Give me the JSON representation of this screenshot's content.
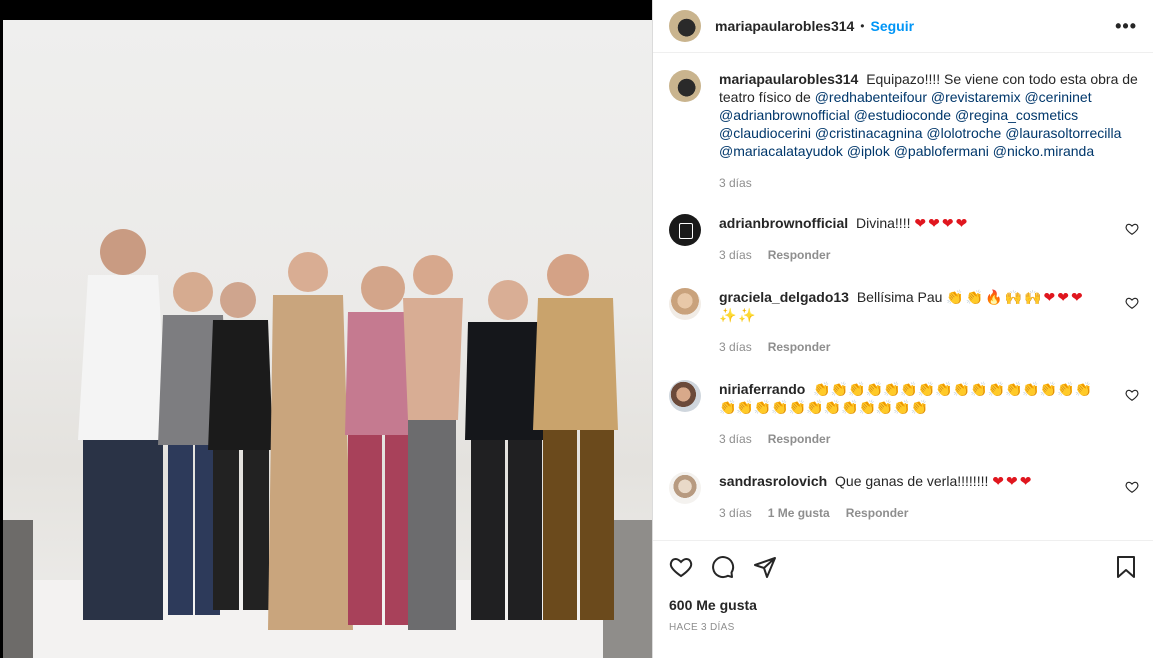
{
  "post": {
    "owner": "mariapaularobles314",
    "follow_label": "Seguir",
    "separator": "•",
    "more_label": "•••"
  },
  "caption": {
    "user": "mariapaularobles314",
    "text": "Equipazo!!!! Se viene con todo esta obra de teatro físico de",
    "mentions": "@redhabenteifour @revistaremix @cerininet @adrianbrownofficial @estudioconde @regina_cosmetics @claudiocerini @cristinacagnina @lolotroche @laurasoltorrecilla @mariacalatayudok @iplok @pablofermani @nicko.miranda",
    "time": "3 días"
  },
  "comments": [
    {
      "user": "adrianbrownofficial",
      "text": "Divina!!!!",
      "emoji": "❤❤❤❤",
      "time": "3 días",
      "reply": "Responder"
    },
    {
      "user": "graciela_delgado13",
      "text": "Bellísima Pau",
      "emoji": "👏👏🔥🙌🙌❤❤❤ ✨✨",
      "time": "3 días",
      "reply": "Responder"
    },
    {
      "user": "niriaferrando",
      "text": "",
      "emoji": "👏👏👏👏👏👏👏👏👏👏👏👏👏👏👏👏 👏👏👏👏👏👏👏👏👏👏👏👏",
      "time": "3 días",
      "reply": "Responder"
    },
    {
      "user": "sandrasrolovich",
      "text": "Que ganas de verla!!!!!!!!",
      "emoji": "❤❤❤",
      "time": "3 días",
      "likes": "1 Me gusta",
      "reply": "Responder"
    }
  ],
  "footer": {
    "likes": "600 Me gusta",
    "posted": "HACE 3 DÍAS"
  },
  "icons": [
    "heart-icon",
    "comment-icon",
    "share-icon",
    "bookmark-icon",
    "more-icon"
  ],
  "colors": {
    "link": "#00376b",
    "follow": "#0095f6",
    "heart": "#e0161e",
    "muted": "#8e8e8e"
  }
}
